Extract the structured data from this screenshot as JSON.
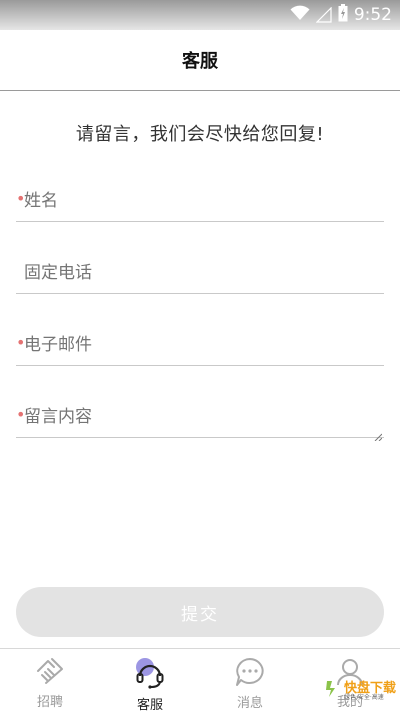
{
  "status_bar": {
    "time": "9:52"
  },
  "header": {
    "title": "客服"
  },
  "intro_text": "请留言，我们会尽快给您回复!",
  "form": {
    "fields": [
      {
        "placeholder": "姓名",
        "required": true
      },
      {
        "placeholder": "固定电话",
        "required": false
      },
      {
        "placeholder": "电子邮件",
        "required": true
      },
      {
        "placeholder": "留言内容",
        "required": true
      }
    ],
    "submit_label": "提交"
  },
  "tabs": [
    {
      "label": "招聘",
      "icon": "handshake-icon",
      "active": false
    },
    {
      "label": "客服",
      "icon": "headset-icon",
      "active": true
    },
    {
      "label": "消息",
      "icon": "chat-bubble-icon",
      "active": false
    },
    {
      "label": "我的",
      "icon": "user-icon",
      "active": false
    }
  ],
  "watermark": {
    "brand": "快盘下载",
    "tagline": "绿色·安全·高速"
  },
  "colors": {
    "required_dot": "#e57373",
    "accent": "#7b74d6",
    "submit_bg": "#e3e3e3"
  }
}
